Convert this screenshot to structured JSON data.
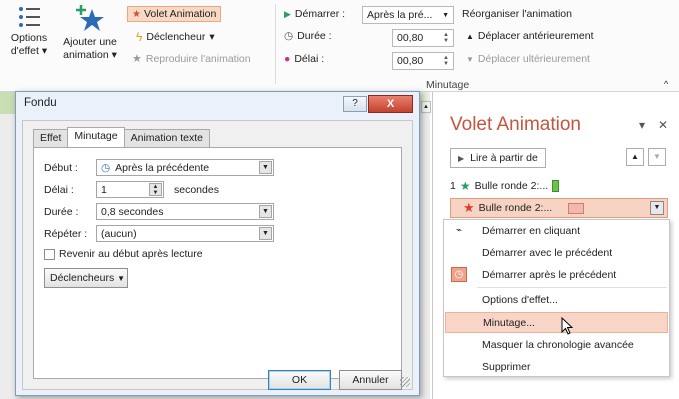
{
  "ribbon": {
    "options_label_1": "Options",
    "options_label_2": "d'effet",
    "add_label_1": "Ajouter une",
    "add_label_2": "animation",
    "anim_pane_label": "Volet Animation",
    "trigger_label": "Déclencheur",
    "reproduce_label": "Reproduire l'animation",
    "start_label": "Démarrer :",
    "start_value": "Après la pré...",
    "duration_label": "Durée :",
    "duration_value": "00,80",
    "delay_label": "Délai :",
    "delay_value": "00,80",
    "reorder_label": "Réorganiser l'animation",
    "move_earlier_label": "Déplacer antérieurement",
    "move_later_label": "Déplacer ultérieurement",
    "timing_group_label": "Minutage"
  },
  "dialog": {
    "title": "Fondu",
    "help": "?",
    "close": "X",
    "tabs": [
      "Effet",
      "Minutage",
      "Animation texte"
    ],
    "start_label": "Début :",
    "start_value": "Après la précédente",
    "delay_label": "Délai :",
    "delay_value": "1",
    "delay_unit": "secondes",
    "duration_label": "Durée :",
    "duration_value": "0,8 secondes",
    "repeat_label": "Répéter :",
    "repeat_value": "(aucun)",
    "rewind_label": "Revenir au début après lecture",
    "triggers_label": "Déclencheurs",
    "ok_label": "OK",
    "cancel_label": "Annuler"
  },
  "pane": {
    "title": "Volet Animation",
    "play_label": "Lire à partir de",
    "items": [
      {
        "index": "1",
        "label": "Bulle ronde 2:..."
      },
      {
        "index": "",
        "label": "Bulle ronde 2:..."
      }
    ]
  },
  "menu": {
    "items": [
      "Démarrer en cliquant",
      "Démarrer avec le précédent",
      "Démarrer après le précédent",
      "Options d'effet...",
      "Minutage...",
      "Masquer la chronologie avancée",
      "Supprimer"
    ]
  },
  "colors": {
    "accent": "#c4563f",
    "highlight": "#f8d5c6",
    "green_star": "#2e9b63",
    "red_star": "#d9412a"
  }
}
